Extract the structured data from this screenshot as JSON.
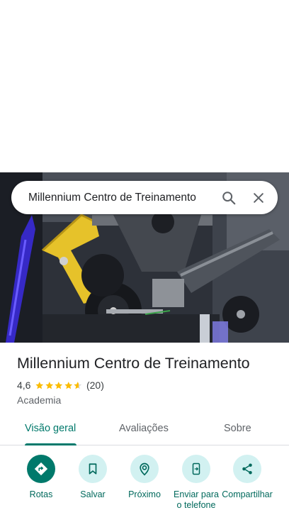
{
  "search": {
    "query": "Millennium Centro de Treinamento",
    "search_icon": "search-icon",
    "close_icon": "close-icon"
  },
  "place": {
    "name": "Millennium Centro de Treinamento",
    "rating": "4,6",
    "rating_value": 4.6,
    "stars_max": 5,
    "review_count": "(20)",
    "category": "Academia"
  },
  "tabs": [
    {
      "label": "Visão geral",
      "active": true
    },
    {
      "label": "Avaliações",
      "active": false
    },
    {
      "label": "Sobre",
      "active": false
    }
  ],
  "actions": [
    {
      "label": "Rotas",
      "icon": "directions-icon"
    },
    {
      "label": "Salvar",
      "icon": "bookmark-icon"
    },
    {
      "label": "Próximo",
      "icon": "nearby-icon"
    },
    {
      "label": "Enviar para o telefone",
      "icon": "send-to-phone-icon"
    },
    {
      "label": "Compartilhar",
      "icon": "share-icon"
    }
  ],
  "colors": {
    "accent": "#00796b",
    "action_bg": "#d2f1f1",
    "star": "#fbbc04"
  }
}
